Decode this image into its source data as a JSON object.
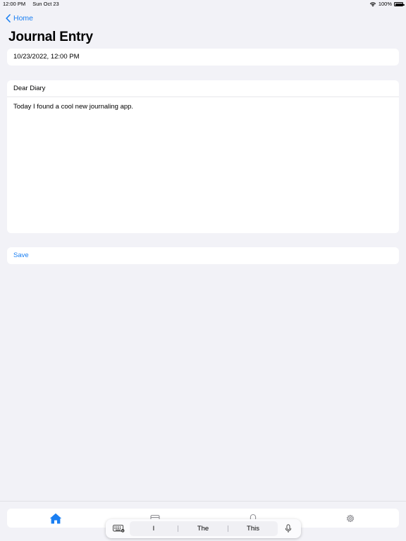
{
  "status_bar": {
    "time": "12:00 PM",
    "date": "Sun Oct 23",
    "battery": "100%",
    "battery_level": 1.0
  },
  "nav": {
    "back_label": "Home",
    "title": "Journal Entry"
  },
  "form": {
    "date_value": "10/23/2022, 12:00 PM",
    "entry_title": "Dear Diary",
    "entry_body": "Today I found a cool new journaling app.",
    "save_label": "Save"
  },
  "tab_bar": {
    "tabs": [
      {
        "icon": "house-icon",
        "selected": true
      },
      {
        "icon": "calendar-icon",
        "selected": false
      },
      {
        "icon": "bell-icon",
        "selected": false
      },
      {
        "icon": "gear-icon",
        "selected": false
      }
    ]
  },
  "keyboard": {
    "suggestions": [
      "I",
      "The",
      "This"
    ]
  },
  "colors": {
    "accent": "#1a7ff2",
    "background": "#f2f2f7",
    "card": "#ffffff",
    "inactive_icon": "#8e8e93"
  }
}
